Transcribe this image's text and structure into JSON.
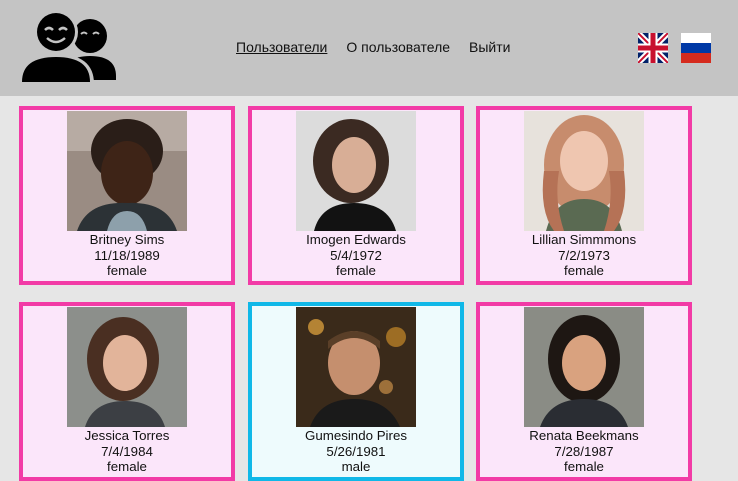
{
  "header": {
    "logo_icon": "users-group-icon",
    "nav": [
      {
        "label": "Пользователи",
        "active": true
      },
      {
        "label": "О пользователе",
        "active": false
      },
      {
        "label": "Выйти",
        "active": false
      }
    ],
    "languages": [
      {
        "name": "uk-flag-icon"
      },
      {
        "name": "ru-flag-icon"
      }
    ]
  },
  "users": [
    {
      "name": "Britney Sims",
      "birthdate": "11/18/1989",
      "gender": "female"
    },
    {
      "name": "Imogen Edwards",
      "birthdate": "5/4/1972",
      "gender": "female"
    },
    {
      "name": "Lillian Simmmons",
      "birthdate": "7/2/1973",
      "gender": "female"
    },
    {
      "name": "Jessica Torres",
      "birthdate": "7/4/1984",
      "gender": "female"
    },
    {
      "name": "Gumesindo Pires",
      "birthdate": "5/26/1981",
      "gender": "male"
    },
    {
      "name": "Renata Beekmans",
      "birthdate": "7/28/1987",
      "gender": "female"
    }
  ],
  "colors": {
    "female_border": "#f23ba6",
    "female_bg": "#fbe6fa",
    "male_border": "#10b8e8",
    "male_bg": "#eefbfd",
    "header_bg": "#c4c4c4"
  }
}
